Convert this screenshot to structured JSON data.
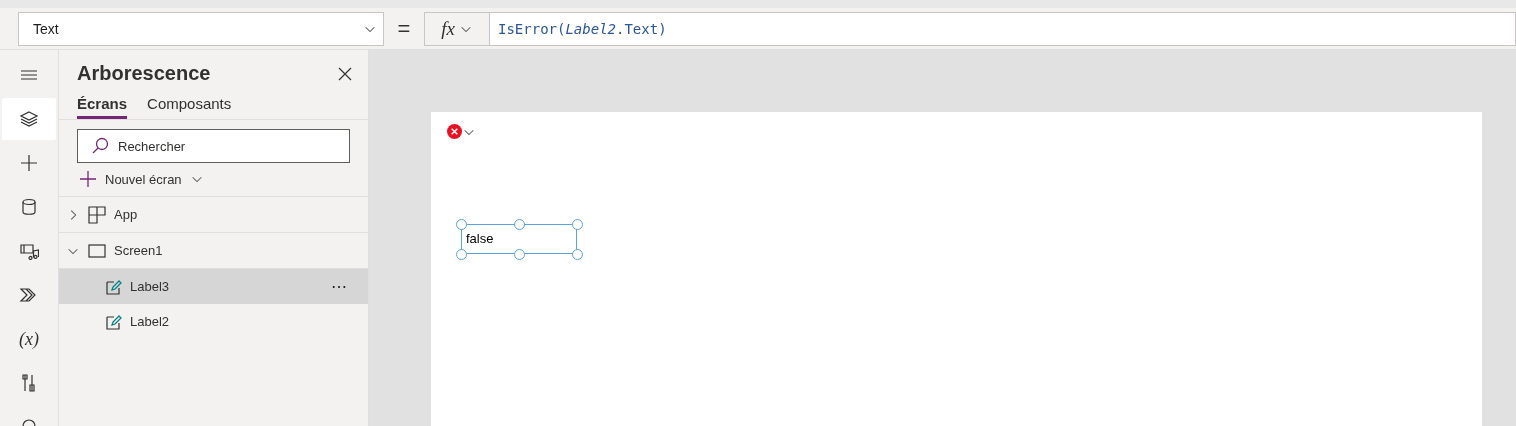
{
  "property": {
    "value": "Text"
  },
  "equals": "=",
  "fx": {
    "label": "fx"
  },
  "formula": "IsError(*Label2*.Text)",
  "rail": [
    {
      "kind": "menu",
      "selected": false
    },
    {
      "kind": "layers",
      "selected": true
    },
    {
      "kind": "insert",
      "selected": false
    },
    {
      "kind": "data",
      "selected": false
    },
    {
      "kind": "media",
      "selected": false
    },
    {
      "kind": "automate",
      "selected": false
    },
    {
      "kind": "variables",
      "label": "(x)",
      "selected": false
    },
    {
      "kind": "tools",
      "selected": false
    },
    {
      "kind": "search",
      "selected": false
    }
  ],
  "tree_panel": {
    "title": "Arborescence",
    "tabs": [
      {
        "label": "Écrans",
        "selected": true
      },
      {
        "label": "Composants",
        "selected": false
      }
    ],
    "search": {
      "placeholder": "Rechercher"
    },
    "new_screen": "Nouvel écran",
    "items": [
      {
        "kind": "app",
        "label": "App",
        "expanded": false,
        "selected": false
      },
      {
        "kind": "screen",
        "label": "Screen1",
        "expanded": true,
        "selected": false,
        "children": [
          {
            "kind": "label",
            "label": "Label3",
            "selected": true,
            "more": "⋯"
          },
          {
            "kind": "label",
            "label": "Label2",
            "selected": false
          }
        ]
      }
    ]
  },
  "canvas": {
    "error": true,
    "label": {
      "text": "false",
      "selected": true
    }
  }
}
